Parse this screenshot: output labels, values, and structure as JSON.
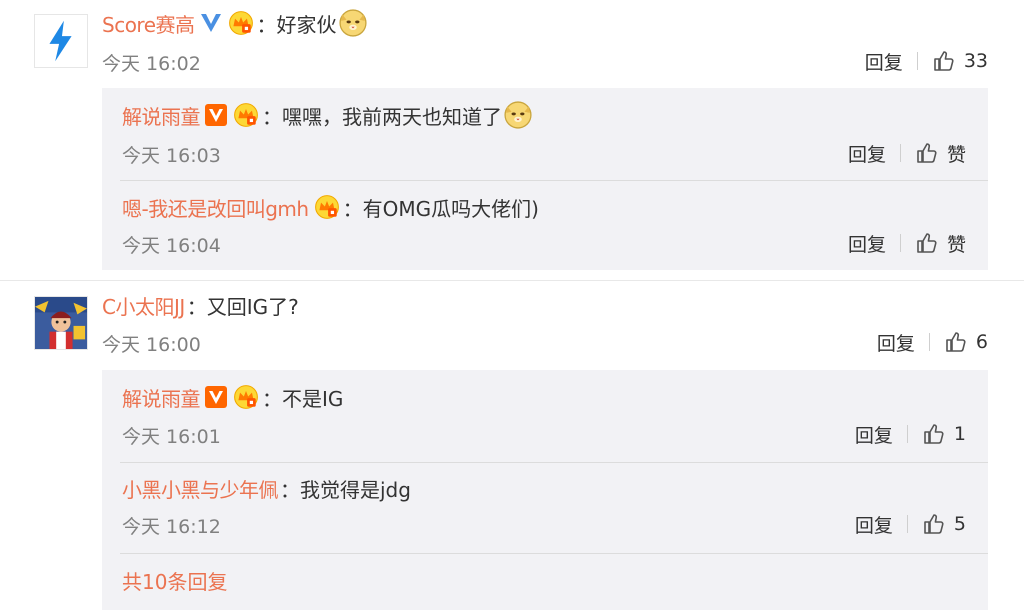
{
  "comments": [
    {
      "user": "Score赛高",
      "text": "好家伙",
      "time": "今天 16:02",
      "reply_label": "回复",
      "like_count": "33",
      "replies": [
        {
          "user": "解说雨童",
          "text": "嘿嘿，我前两天也知道了",
          "time": "今天 16:03",
          "reply_label": "回复",
          "like_label": "赞"
        },
        {
          "user": "嗯-我还是改回叫gmh",
          "text": "有OMG瓜吗大佬们)",
          "time": "今天 16:04",
          "reply_label": "回复",
          "like_label": "赞"
        }
      ]
    },
    {
      "user": "C小太阳JJ",
      "text": "又回IG了?",
      "time": "今天 16:00",
      "reply_label": "回复",
      "like_count": "6",
      "replies": [
        {
          "user": "解说雨童",
          "text": "不是IG",
          "time": "今天 16:01",
          "reply_label": "回复",
          "like_count": "1"
        },
        {
          "user": "小黑小黑与少年佩",
          "text": "我觉得是jdg",
          "time": "今天 16:12",
          "reply_label": "回复",
          "like_count": "5"
        }
      ],
      "more_replies": "共10条回复"
    }
  ],
  "colon": "：",
  "icons": {
    "verified_blue": "verified-v-icon",
    "verified_orange": "verified-v-icon",
    "member": "member-crown-icon",
    "like": "thumbs-up-icon",
    "emoji": "doge-emoji-icon"
  },
  "colors": {
    "username": "#eb7350",
    "text": "#333333",
    "time": "#808080",
    "reply_bg": "#f2f2f5",
    "verified_blue": "#4a90e2",
    "verified_orange": "#ff6600"
  }
}
